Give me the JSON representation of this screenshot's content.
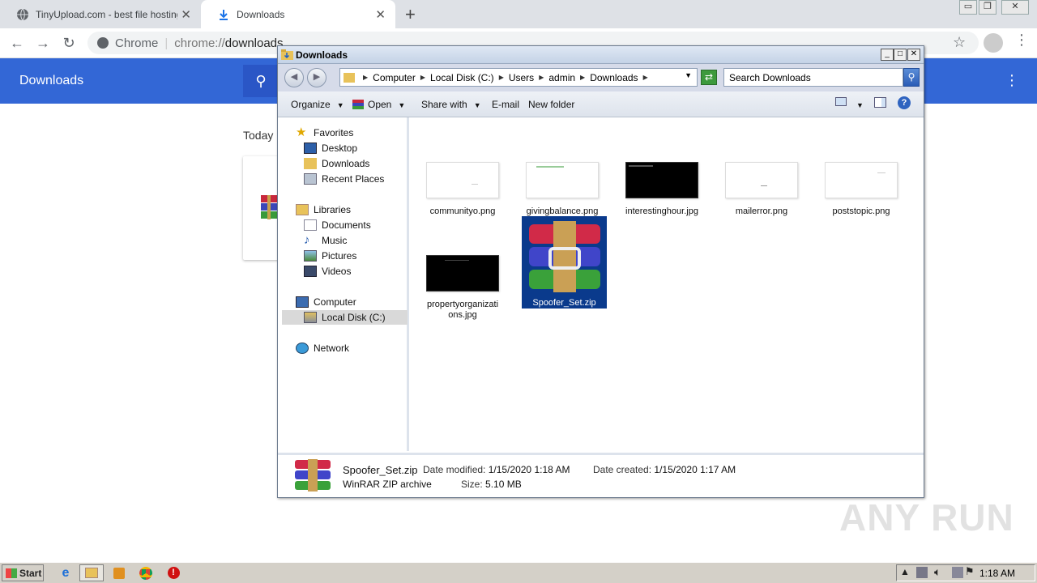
{
  "chrome": {
    "tabs": [
      {
        "title": "TinyUpload.com - best file hosting so",
        "active": false
      },
      {
        "title": "Downloads",
        "active": true
      }
    ],
    "omnibox": {
      "site_chip": "Chrome",
      "url_scheme": "chrome://",
      "url_host": "downloads"
    }
  },
  "downloads_page": {
    "header_title": "Downloads",
    "section_label": "Today"
  },
  "explorer": {
    "title": "Downloads",
    "breadcrumb": [
      "Computer",
      "Local Disk (C:)",
      "Users",
      "admin",
      "Downloads"
    ],
    "search_placeholder": "Search Downloads",
    "commands": {
      "organize": "Organize",
      "open": "Open",
      "share_with": "Share with",
      "email": "E-mail",
      "new_folder": "New folder"
    },
    "nav": {
      "favorites": "Favorites",
      "desktop": "Desktop",
      "downloads": "Downloads",
      "recent_places": "Recent Places",
      "libraries": "Libraries",
      "documents": "Documents",
      "music": "Music",
      "pictures": "Pictures",
      "videos": "Videos",
      "computer": "Computer",
      "local_disk": "Local Disk (C:)",
      "network": "Network"
    },
    "files": [
      {
        "name": "communityo.png"
      },
      {
        "name": "givingbalance.png"
      },
      {
        "name": "interestinghour.jpg"
      },
      {
        "name": "mailerror.png"
      },
      {
        "name": "poststopic.png"
      },
      {
        "name": "propertyorganizations.jpg"
      },
      {
        "name": "Spoofer_Set.zip",
        "selected": true
      }
    ],
    "details": {
      "name": "Spoofer_Set.zip",
      "type": "WinRAR ZIP archive",
      "modified_label": "Date modified:",
      "modified_value": "1/15/2020 1:18 AM",
      "created_label": "Date created:",
      "created_value": "1/15/2020 1:17 AM",
      "size_label": "Size:",
      "size_value": "5.10 MB"
    }
  },
  "taskbar": {
    "start_label": "Start",
    "clock": "1:18 AM"
  },
  "watermark": "ANY RUN",
  "colors": {
    "chrome_blue": "#3367d6",
    "selection": "#0a3a8c"
  }
}
